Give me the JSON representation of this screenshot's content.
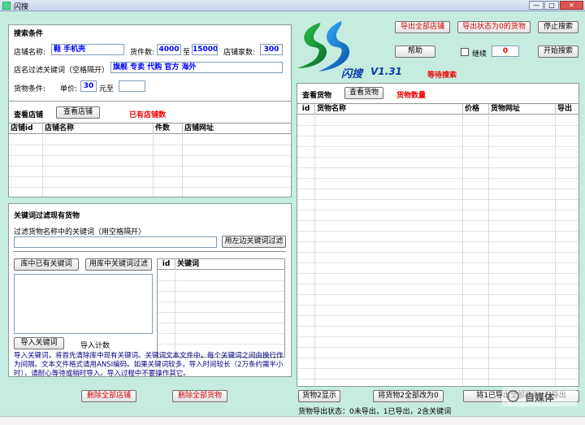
{
  "window": {
    "title": "闪搜",
    "minimize": "—",
    "maximize": "□",
    "close": "✕"
  },
  "search": {
    "title": "搜索条件",
    "shop_name_label": "店铺名称:",
    "shop_name_value": "鞋 手机壳",
    "goods_count_label": "货件数:",
    "goods_min": "4000",
    "to_label": "至",
    "goods_max": "15000",
    "shop_count_label": "店铺家数:",
    "shop_count": "300",
    "filter_label": "店名过滤关键词（空格隔开）",
    "filter_value": "旗舰 专卖 代购 官方 海外",
    "goods_cond_label": "货物条件:",
    "price_label": "单价:",
    "price_min": "30",
    "price_to_label": "元至",
    "price_max": ""
  },
  "shops": {
    "title": "查看店铺",
    "view_button": "查看店铺",
    "status": "已有店铺数",
    "columns": [
      "店铺id",
      "店铺名称",
      "件数",
      "店铺网址"
    ]
  },
  "keywords": {
    "title": "关键词过滤现有货物",
    "filter_hint": "过滤货物名称中的关键词（用空格隔开）",
    "filter_input": "",
    "filter_button": "用左边关键词过滤",
    "lib_button": "库中已有关键词",
    "lib_filter_button": "用库中关键词过滤",
    "list_columns": [
      "id",
      "关键词"
    ],
    "import_button": "导入关键词",
    "import_count_label": "导入计数",
    "note": "导入关键词，将首先清除库中现有关键词。关键词文本文件中，每个关键词之间由换行作为间隔。文本文件格式请用ANSI编码。如果关键词较多，导入时间较长（2万条约需半小时），请耐心等待或稍时导入。导入过程中不要操作其它。"
  },
  "bottom_left": {
    "delete_shops": "删除全部店铺",
    "delete_goods": "删除全部货物"
  },
  "logo": {
    "app_name": "闪搜",
    "version": "V1.31",
    "status": "等待搜索"
  },
  "top_right": {
    "export_shops": "导出全部店铺",
    "export_status0": "导出状态为0的货物",
    "stop_search": "停止搜索",
    "help": "帮助",
    "continue_label": "继续",
    "continue_value": "0",
    "start_search": "开始搜索"
  },
  "goods": {
    "title": "查看货物",
    "view_button": "查看货物",
    "count_label": "货物数量",
    "columns": [
      "id",
      "货物名称",
      "价格",
      "货物网址",
      "导出"
    ]
  },
  "bottom_right": {
    "show2": "货物2显示",
    "set_all0": "将货物2全部改为0",
    "set1_btn": "将1已导出全部改为2已导出",
    "status_note": "货物导出状态：0未导出，1已导出，2含关键词"
  },
  "watermark": "自媒体"
}
